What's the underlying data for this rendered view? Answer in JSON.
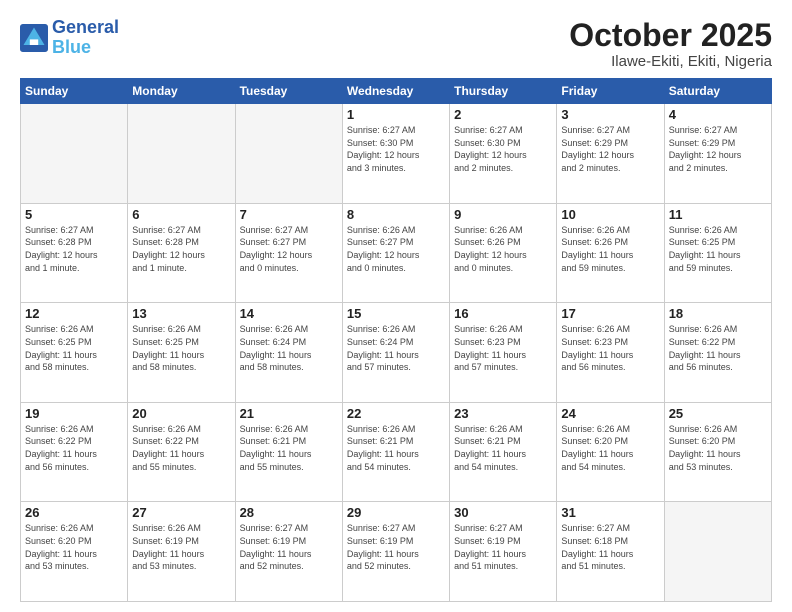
{
  "header": {
    "logo_line1": "General",
    "logo_line2": "Blue",
    "month": "October 2025",
    "location": "Ilawe-Ekiti, Ekiti, Nigeria"
  },
  "weekdays": [
    "Sunday",
    "Monday",
    "Tuesday",
    "Wednesday",
    "Thursday",
    "Friday",
    "Saturday"
  ],
  "weeks": [
    [
      {
        "day": "",
        "info": ""
      },
      {
        "day": "",
        "info": ""
      },
      {
        "day": "",
        "info": ""
      },
      {
        "day": "1",
        "info": "Sunrise: 6:27 AM\nSunset: 6:30 PM\nDaylight: 12 hours\nand 3 minutes."
      },
      {
        "day": "2",
        "info": "Sunrise: 6:27 AM\nSunset: 6:30 PM\nDaylight: 12 hours\nand 2 minutes."
      },
      {
        "day": "3",
        "info": "Sunrise: 6:27 AM\nSunset: 6:29 PM\nDaylight: 12 hours\nand 2 minutes."
      },
      {
        "day": "4",
        "info": "Sunrise: 6:27 AM\nSunset: 6:29 PM\nDaylight: 12 hours\nand 2 minutes."
      }
    ],
    [
      {
        "day": "5",
        "info": "Sunrise: 6:27 AM\nSunset: 6:28 PM\nDaylight: 12 hours\nand 1 minute."
      },
      {
        "day": "6",
        "info": "Sunrise: 6:27 AM\nSunset: 6:28 PM\nDaylight: 12 hours\nand 1 minute."
      },
      {
        "day": "7",
        "info": "Sunrise: 6:27 AM\nSunset: 6:27 PM\nDaylight: 12 hours\nand 0 minutes."
      },
      {
        "day": "8",
        "info": "Sunrise: 6:26 AM\nSunset: 6:27 PM\nDaylight: 12 hours\nand 0 minutes."
      },
      {
        "day": "9",
        "info": "Sunrise: 6:26 AM\nSunset: 6:26 PM\nDaylight: 12 hours\nand 0 minutes."
      },
      {
        "day": "10",
        "info": "Sunrise: 6:26 AM\nSunset: 6:26 PM\nDaylight: 11 hours\nand 59 minutes."
      },
      {
        "day": "11",
        "info": "Sunrise: 6:26 AM\nSunset: 6:25 PM\nDaylight: 11 hours\nand 59 minutes."
      }
    ],
    [
      {
        "day": "12",
        "info": "Sunrise: 6:26 AM\nSunset: 6:25 PM\nDaylight: 11 hours\nand 58 minutes."
      },
      {
        "day": "13",
        "info": "Sunrise: 6:26 AM\nSunset: 6:25 PM\nDaylight: 11 hours\nand 58 minutes."
      },
      {
        "day": "14",
        "info": "Sunrise: 6:26 AM\nSunset: 6:24 PM\nDaylight: 11 hours\nand 58 minutes."
      },
      {
        "day": "15",
        "info": "Sunrise: 6:26 AM\nSunset: 6:24 PM\nDaylight: 11 hours\nand 57 minutes."
      },
      {
        "day": "16",
        "info": "Sunrise: 6:26 AM\nSunset: 6:23 PM\nDaylight: 11 hours\nand 57 minutes."
      },
      {
        "day": "17",
        "info": "Sunrise: 6:26 AM\nSunset: 6:23 PM\nDaylight: 11 hours\nand 56 minutes."
      },
      {
        "day": "18",
        "info": "Sunrise: 6:26 AM\nSunset: 6:22 PM\nDaylight: 11 hours\nand 56 minutes."
      }
    ],
    [
      {
        "day": "19",
        "info": "Sunrise: 6:26 AM\nSunset: 6:22 PM\nDaylight: 11 hours\nand 56 minutes."
      },
      {
        "day": "20",
        "info": "Sunrise: 6:26 AM\nSunset: 6:22 PM\nDaylight: 11 hours\nand 55 minutes."
      },
      {
        "day": "21",
        "info": "Sunrise: 6:26 AM\nSunset: 6:21 PM\nDaylight: 11 hours\nand 55 minutes."
      },
      {
        "day": "22",
        "info": "Sunrise: 6:26 AM\nSunset: 6:21 PM\nDaylight: 11 hours\nand 54 minutes."
      },
      {
        "day": "23",
        "info": "Sunrise: 6:26 AM\nSunset: 6:21 PM\nDaylight: 11 hours\nand 54 minutes."
      },
      {
        "day": "24",
        "info": "Sunrise: 6:26 AM\nSunset: 6:20 PM\nDaylight: 11 hours\nand 54 minutes."
      },
      {
        "day": "25",
        "info": "Sunrise: 6:26 AM\nSunset: 6:20 PM\nDaylight: 11 hours\nand 53 minutes."
      }
    ],
    [
      {
        "day": "26",
        "info": "Sunrise: 6:26 AM\nSunset: 6:20 PM\nDaylight: 11 hours\nand 53 minutes."
      },
      {
        "day": "27",
        "info": "Sunrise: 6:26 AM\nSunset: 6:19 PM\nDaylight: 11 hours\nand 53 minutes."
      },
      {
        "day": "28",
        "info": "Sunrise: 6:27 AM\nSunset: 6:19 PM\nDaylight: 11 hours\nand 52 minutes."
      },
      {
        "day": "29",
        "info": "Sunrise: 6:27 AM\nSunset: 6:19 PM\nDaylight: 11 hours\nand 52 minutes."
      },
      {
        "day": "30",
        "info": "Sunrise: 6:27 AM\nSunset: 6:19 PM\nDaylight: 11 hours\nand 51 minutes."
      },
      {
        "day": "31",
        "info": "Sunrise: 6:27 AM\nSunset: 6:18 PM\nDaylight: 11 hours\nand 51 minutes."
      },
      {
        "day": "",
        "info": ""
      }
    ]
  ]
}
